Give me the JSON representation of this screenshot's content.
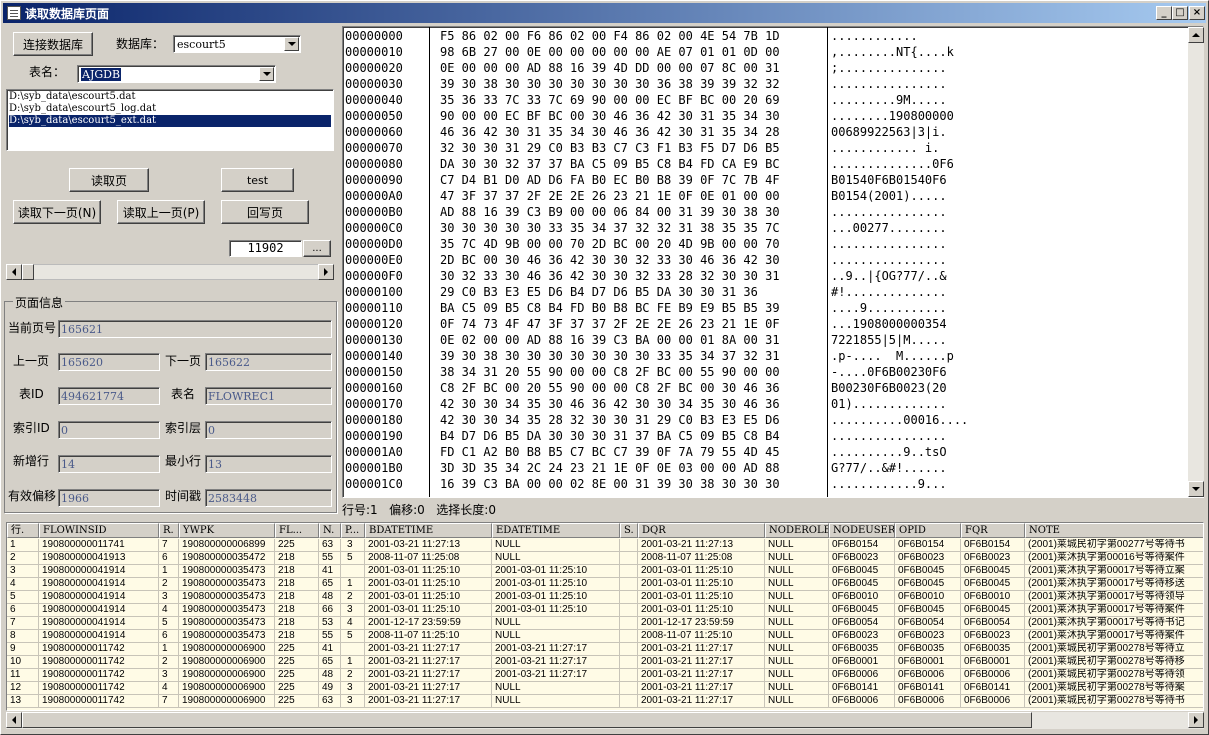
{
  "window": {
    "title": "读取数据库页面",
    "min": "_",
    "max": "□",
    "close": "×"
  },
  "controls": {
    "connect_btn": "连接数据库",
    "db_label": "数据库：",
    "db_value": "escourt5",
    "table_label": "表名：",
    "table_value": "AJGDB",
    "files": [
      "D:\\syb_data\\escourt5.dat",
      "D:\\syb_data\\escourt5_log.dat",
      "D:\\syb_data\\escourt5_ext.dat"
    ],
    "read_page_btn": "读取页",
    "test_btn": "test",
    "next_page_btn": "读取下一页(N)",
    "prev_page_btn": "读取上一页(P)",
    "write_back_btn": "回写页",
    "page_input": "11902",
    "browse_btn": "..."
  },
  "page_info": {
    "group_title": "页面信息",
    "current_page_label": "当前页号",
    "current_page": "165621",
    "prev_label": "上一页",
    "prev": "165620",
    "next_label": "下一页",
    "next": "165622",
    "table_id_label": "表ID",
    "table_id": "494621774",
    "table_name_label": "表名",
    "table_name": "FLOWREC1",
    "index_id_label": "索引ID",
    "index_id": "0",
    "index_level_label": "索引层",
    "index_level": "0",
    "new_row_label": "新增行",
    "new_row": "14",
    "min_row_label": "最小行",
    "min_row": "13",
    "valid_offset_label": "有效偏移",
    "valid_offset": "1966",
    "timestamp_label": "时间戳",
    "timestamp": "2583448"
  },
  "hex": [
    {
      "off": "00000000",
      "hex": "F5 86 02 00 F6 86 02 00 F4 86 02 00 4E 54 7B 1D",
      "asc": "............"
    },
    {
      "off": "00000010",
      "hex": "98 6B 27 00 0E 00 00 00 00 00 AE 07 01 01 0D 00",
      "asc": ",........NT{....k"
    },
    {
      "off": "00000020",
      "hex": "0E 00 00 00 AD 88 16 39 4D DD 00 00 07 8C 00 31",
      "asc": ";..............."
    },
    {
      "off": "00000030",
      "hex": "39 30 38 30 30 30 30 30 30 30 36 38 39 39 32 32",
      "asc": "................"
    },
    {
      "off": "00000040",
      "hex": "35 36 33 7C 33 7C 69 90 00 00 EC BF BC 00 20 69",
      "asc": ".........9M....."
    },
    {
      "off": "00000050",
      "hex": "90 00 00 EC BF BC 00 30 46 36 42 30 31 35 34 30",
      "asc": "........190800000"
    },
    {
      "off": "00000060",
      "hex": "46 36 42 30 31 35 34 30 46 36 42 30 31 35 34 28",
      "asc": "00689922563|3|i."
    },
    {
      "off": "00000070",
      "hex": "32 30 30 31 29 C0 B3 B3 C7 C3 F1 B3 F5 D7 D6 B5",
      "asc": "............ i."
    },
    {
      "off": "00000080",
      "hex": "DA 30 30 32 37 37 BA C5 09 B5 C8 B4 FD CA E9 BC",
      "asc": "..............0F6"
    },
    {
      "off": "00000090",
      "hex": "C7 D4 B1 D0 AD D6 FA B0 EC B0 B8 39 0F 7C 7B 4F",
      "asc": "B01540F6B01540F6"
    },
    {
      "off": "000000A0",
      "hex": "47 3F 37 37 2F 2E 2E 26 23 21 1E 0F 0E 01 00 00",
      "asc": "B0154(2001)....."
    },
    {
      "off": "000000B0",
      "hex": "AD 88 16 39 C3 B9 00 00 06 84 00 31 39 30 38 30",
      "asc": "................"
    },
    {
      "off": "000000C0",
      "hex": "30 30 30 30 30 33 35 34 37 32 32 31 38 35 35 7C",
      "asc": "...00277........"
    },
    {
      "off": "000000D0",
      "hex": "35 7C 4D 9B 00 00 70 2D BC 00 20 4D 9B 00 00 70",
      "asc": "................"
    },
    {
      "off": "000000E0",
      "hex": "2D BC 00 30 46 36 42 30 30 32 33 30 46 36 42 30",
      "asc": "................"
    },
    {
      "off": "000000F0",
      "hex": "30 32 33 30 46 36 42 30 30 32 33 28 32 30 30 31",
      "asc": "..9..|{OG?77/..&"
    },
    {
      "off": "00000100",
      "hex": "29 C0 B3 E3 E5 D6 B4 D7 D6 B5 DA 30 30 31 36",
      "asc": "#!.............."
    },
    {
      "off": "00000110",
      "hex": "BA C5 09 B5 C8 B4 FD B0 B8 BC FE B9 E9 B5 B5 39",
      "asc": "....9..........."
    },
    {
      "off": "00000120",
      "hex": "0F 74 73 4F 47 3F 37 37 2F 2E 2E 26 23 21 1E 0F",
      "asc": "...1908000000354"
    },
    {
      "off": "00000130",
      "hex": "0E 02 00 00 AD 88 16 39 C3 BA 00 00 01 8A 00 31",
      "asc": "7221855|5|M....."
    },
    {
      "off": "00000140",
      "hex": "39 30 38 30 30 30 30 30 30 30 33 35 34 37 32 31",
      "asc": ".p-....  M......p"
    },
    {
      "off": "00000150",
      "hex": "38 34 31 20 55 90 00 00 C8 2F BC 00 55 90 00 00",
      "asc": "-....0F6B00230F6"
    },
    {
      "off": "00000160",
      "hex": "C8 2F BC 00 20 55 90 00 00 C8 2F BC 00 30 46 36",
      "asc": "B00230F6B0023(20"
    },
    {
      "off": "00000170",
      "hex": "42 30 30 34 35 30 46 36 42 30 30 34 35 30 46 36",
      "asc": "01)............."
    },
    {
      "off": "00000180",
      "hex": "42 30 30 34 35 28 32 30 30 31 29 C0 B3 E3 E5 D6",
      "asc": "..........00016...."
    },
    {
      "off": "00000190",
      "hex": "B4 D7 D6 B5 DA 30 30 30 31 37 BA C5 09 B5 C8 B4",
      "asc": "................"
    },
    {
      "off": "000001A0",
      "hex": "FD C1 A2 B0 B8 B5 C7 BC C7 39 0F 7A 79 55 4D 45",
      "asc": "..........9..tsO"
    },
    {
      "off": "000001B0",
      "hex": "3D 3D 35 34 2C 24 23 21 1E 0F 0E 03 00 00 AD 88",
      "asc": "G?77/..&#!......"
    },
    {
      "off": "000001C0",
      "hex": "16 39 C3 BA 00 00 02 8E 00 31 39 30 38 30 30 30",
      "asc": "............9..."
    }
  ],
  "status": {
    "row": "行号:1",
    "offset": "偏移:0",
    "sel_len": "选择长度:0"
  },
  "grid": {
    "headers": [
      "行.",
      "FLOWINSID",
      "R.",
      "YWPK",
      "FL...",
      "N.",
      "P...",
      "BDATETIME",
      "EDATETIME",
      "S.",
      "DQR",
      "NODEROLE",
      "NODEUSER",
      "OPID",
      "FQR",
      "NOTE"
    ],
    "rows": [
      [
        "1",
        "190800000011741",
        "7",
        "190800000006899",
        "225",
        "63",
        "3",
        "2001-03-21  11:27:13",
        "NULL",
        "",
        "2001-03-21  11:27:13",
        "NULL",
        "0F6B0154",
        "0F6B0154",
        "0F6B0154",
        "(2001)莱城民初字第00277号等待书"
      ],
      [
        "2",
        "190800000041913",
        "6",
        "190800000035472",
        "218",
        "55",
        "5",
        "2008-11-07  11:25:08",
        "NULL",
        "",
        "2008-11-07  11:25:08",
        "NULL",
        "0F6B0023",
        "0F6B0023",
        "0F6B0023",
        "(2001)莱沐执字第00016号等待案件"
      ],
      [
        "3",
        "190800000041914",
        "1",
        "190800000035473",
        "218",
        "41",
        "",
        "2001-03-01  11:25:10",
        "2001-03-01  11:25:10",
        "",
        "2001-03-01  11:25:10",
        "NULL",
        "0F6B0045",
        "0F6B0045",
        "0F6B0045",
        "(2001)莱沐执字第00017号等待立案"
      ],
      [
        "4",
        "190800000041914",
        "2",
        "190800000035473",
        "218",
        "65",
        "1",
        "2001-03-01  11:25:10",
        "2001-03-01  11:25:10",
        "",
        "2001-03-01  11:25:10",
        "NULL",
        "0F6B0045",
        "0F6B0045",
        "0F6B0045",
        "(2001)莱沐执字第00017号等待移送"
      ],
      [
        "5",
        "190800000041914",
        "3",
        "190800000035473",
        "218",
        "48",
        "2",
        "2001-03-01  11:25:10",
        "2001-03-01  11:25:10",
        "",
        "2001-03-01  11:25:10",
        "NULL",
        "0F6B0010",
        "0F6B0010",
        "0F6B0010",
        "(2001)莱沐执字第00017号等待领导"
      ],
      [
        "6",
        "190800000041914",
        "4",
        "190800000035473",
        "218",
        "66",
        "3",
        "2001-03-01  11:25:10",
        "2001-03-01  11:25:10",
        "",
        "2001-03-01  11:25:10",
        "NULL",
        "0F6B0045",
        "0F6B0045",
        "0F6B0045",
        "(2001)莱沐执字第00017号等待案件"
      ],
      [
        "7",
        "190800000041914",
        "5",
        "190800000035473",
        "218",
        "53",
        "4",
        "2001-12-17  23:59:59",
        "NULL",
        "",
        "2001-12-17  23:59:59",
        "NULL",
        "0F6B0054",
        "0F6B0054",
        "0F6B0054",
        "(2001)莱沐执字第00017号等待书记"
      ],
      [
        "8",
        "190800000041914",
        "6",
        "190800000035473",
        "218",
        "55",
        "5",
        "2008-11-07  11:25:10",
        "NULL",
        "",
        "2008-11-07  11:25:10",
        "NULL",
        "0F6B0023",
        "0F6B0023",
        "0F6B0023",
        "(2001)莱沐执字第00017号等待案件"
      ],
      [
        "9",
        "190800000011742",
        "1",
        "190800000006900",
        "225",
        "41",
        "",
        "2001-03-21  11:27:17",
        "2001-03-21  11:27:17",
        "",
        "2001-03-21  11:27:17",
        "NULL",
        "0F6B0035",
        "0F6B0035",
        "0F6B0035",
        "(2001)莱城民初字第00278号等待立"
      ],
      [
        "10",
        "190800000011742",
        "2",
        "190800000006900",
        "225",
        "65",
        "1",
        "2001-03-21  11:27:17",
        "2001-03-21  11:27:17",
        "",
        "2001-03-21  11:27:17",
        "NULL",
        "0F6B0001",
        "0F6B0001",
        "0F6B0001",
        "(2001)莱城民初字第00278号等待移"
      ],
      [
        "11",
        "190800000011742",
        "3",
        "190800000006900",
        "225",
        "48",
        "2",
        "2001-03-21  11:27:17",
        "2001-03-21  11:27:17",
        "",
        "2001-03-21  11:27:17",
        "NULL",
        "0F6B0006",
        "0F6B0006",
        "0F6B0006",
        "(2001)莱城民初字第00278号等待领"
      ],
      [
        "12",
        "190800000011742",
        "4",
        "190800000006900",
        "225",
        "49",
        "3",
        "2001-03-21  11:27:17",
        "NULL",
        "",
        "2001-03-21  11:27:17",
        "NULL",
        "0F6B0141",
        "0F6B0141",
        "0F6B0141",
        "(2001)莱城民初字第00278号等待案"
      ],
      [
        "13",
        "190800000011742",
        "7",
        "190800000006900",
        "225",
        "63",
        "3",
        "2001-03-21  11:27:17",
        "NULL",
        "",
        "2001-03-21  11:27:17",
        "NULL",
        "0F6B0006",
        "0F6B0006",
        "0F6B0006",
        "(2001)莱城民初字第00278号等待书"
      ]
    ]
  }
}
